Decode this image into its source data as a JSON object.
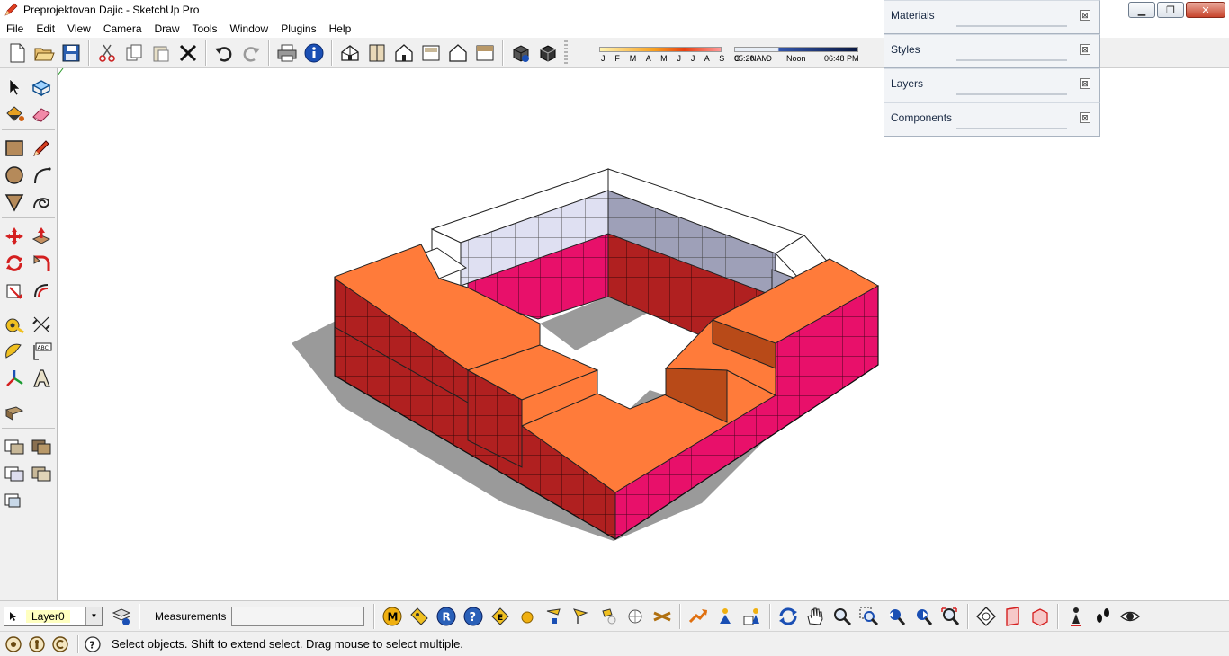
{
  "window": {
    "title": "Preprojektovan Dajic - SketchUp Pro",
    "minimize_label": "▁",
    "maximize_label": "❐",
    "close_label": "✕"
  },
  "menu": [
    "File",
    "Edit",
    "View",
    "Camera",
    "Draw",
    "Tools",
    "Window",
    "Plugins",
    "Help"
  ],
  "shadow": {
    "months": "J F M A M J J A S O N D",
    "time_start": "05:20 AM",
    "time_mid": "Noon",
    "time_end": "06:48 PM"
  },
  "trays": [
    {
      "title": "Materials",
      "close": "⊠"
    },
    {
      "title": "Styles",
      "close": "⊠"
    },
    {
      "title": "Layers",
      "close": "⊠"
    },
    {
      "title": "Components",
      "close": "⊠"
    }
  ],
  "bottom": {
    "layer_value": "Layer0",
    "dropdown_arrow": "▼",
    "measurements_label": "Measurements",
    "measurements_value": ""
  },
  "status": {
    "text": "Select objects. Shift to extend select. Drag mouse to select multiple."
  },
  "colors": {
    "wall_top": "#ff7b3a",
    "wall_side_red": "#b02020",
    "wall_side_pink": "#e8106a",
    "top_course": "#ffffff",
    "shadow": "#9a9a9a"
  }
}
